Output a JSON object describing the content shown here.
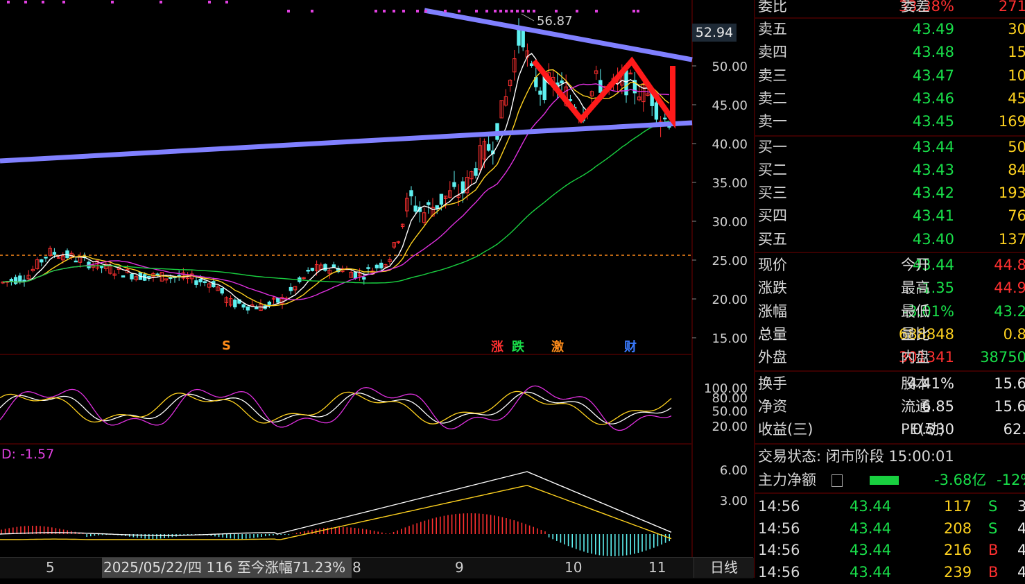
{
  "chart": {
    "price_axis": [
      "50.00",
      "45.00",
      "40.00",
      "35.00",
      "30.00",
      "25.00",
      "20.00",
      "15.00"
    ],
    "current_price_tag": "52.94",
    "high_annotation": "56.87",
    "kdj_axis": [
      "100.00",
      "80.00",
      "50.00",
      "20.00"
    ],
    "macd_axis": [
      "6.00",
      "3.00"
    ],
    "macd_label": "D: -1.57",
    "event_badges": [
      {
        "text": "S",
        "color": "#ff8c1a"
      },
      {
        "text": "涨",
        "color": "#ff3030"
      },
      {
        "text": "跌",
        "color": "#19e04a"
      },
      {
        "text": "激",
        "color": "#ff8c1a"
      },
      {
        "text": "财",
        "color": "#3a7bff"
      }
    ],
    "colors": {
      "up": "#ff3030",
      "down": "#5ef0f0",
      "ma5": "#ffffff",
      "ma10": "#ffd21f",
      "ma20": "#e030e0",
      "ma60": "#19d040",
      "trendline": "#8080ff",
      "pattern": "#ff1a1a",
      "dashed": "#ff8c1a"
    }
  },
  "bottom_bar": {
    "ticks": [
      "5",
      "8",
      "9",
      "10",
      "11"
    ],
    "cursor_info": "2025/05/22/四 116 至今涨幅71.23%",
    "period": "日线"
  },
  "quote_panel": {
    "top_row": {
      "label": "委比",
      "value": "33.38%",
      "label2": "委差",
      "value2": "271"
    },
    "asks": [
      {
        "label": "卖五",
        "price": "43.49",
        "vol": "30"
      },
      {
        "label": "卖四",
        "price": "43.48",
        "vol": "15"
      },
      {
        "label": "卖三",
        "price": "43.47",
        "vol": "10"
      },
      {
        "label": "卖二",
        "price": "43.46",
        "vol": "45"
      },
      {
        "label": "卖一",
        "price": "43.45",
        "vol": "169"
      }
    ],
    "bids": [
      {
        "label": "买一",
        "price": "43.44",
        "vol": "50"
      },
      {
        "label": "买二",
        "price": "43.43",
        "vol": "84"
      },
      {
        "label": "买三",
        "price": "43.42",
        "vol": "193"
      },
      {
        "label": "买四",
        "price": "43.41",
        "vol": "76"
      },
      {
        "label": "买五",
        "price": "43.40",
        "vol": "137"
      }
    ],
    "stats": [
      {
        "label": "现价",
        "value": "43.44",
        "vclass": "green",
        "label2": "今开",
        "value2": "44.8",
        "v2class": "red"
      },
      {
        "label": "涨跌",
        "value": "-1.35",
        "vclass": "green",
        "label2": "最高",
        "value2": "44.9",
        "v2class": "red"
      },
      {
        "label": "涨幅",
        "value": "-3.01%",
        "vclass": "green",
        "label2": "最低",
        "value2": "43.2",
        "v2class": "green"
      },
      {
        "label": "总量",
        "value": "688848",
        "vclass": "yellow",
        "label2": "量比",
        "value2": "0.8",
        "v2class": "yellow"
      },
      {
        "label": "外盘",
        "value": "301341",
        "vclass": "red",
        "label2": "内盘",
        "value2": "38750",
        "v2class": "green"
      }
    ],
    "fundamentals": [
      {
        "label": "换手",
        "value": "4.41%",
        "label2": "股本",
        "value2": "15.6"
      },
      {
        "label": "净资",
        "value": "6.85",
        "label2": "流通",
        "value2": "15.6"
      },
      {
        "label": "收益(三)",
        "value": "0.530",
        "label2": "PE(动)",
        "value2": "62."
      }
    ],
    "trade_status": "交易状态: 闭市阶段 15:00:01",
    "main_flow": {
      "label": "主力净额",
      "value": "-3.68亿",
      "value2": "-12%"
    },
    "ticks": [
      {
        "time": "14:56",
        "price": "43.44",
        "vol": "117",
        "side": "S",
        "n": "3"
      },
      {
        "time": "14:56",
        "price": "43.44",
        "vol": "208",
        "side": "S",
        "n": "4"
      },
      {
        "time": "14:56",
        "price": "43.44",
        "vol": "216",
        "side": "B",
        "n": "4"
      },
      {
        "time": "14:56",
        "price": "43.44",
        "vol": "239",
        "side": "B",
        "n": "4"
      }
    ]
  }
}
